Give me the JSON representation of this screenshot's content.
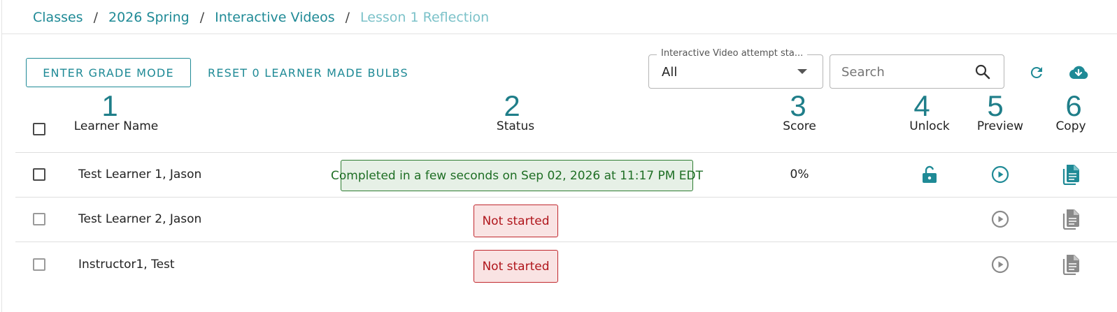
{
  "breadcrumb": {
    "items": [
      "Classes",
      "2026 Spring",
      "Interactive Videos"
    ],
    "separator": "/",
    "current": "Lesson 1 Reflection"
  },
  "toolbar": {
    "grade_mode_label": "ENTER GRADE MODE",
    "reset_bulbs_label": "RESET 0 LEARNER MADE BULBS",
    "attempt_filter": {
      "label": "Interactive Video attempt sta...",
      "value": "All"
    },
    "search": {
      "placeholder": "Search",
      "value": ""
    },
    "refresh_icon": "refresh-icon",
    "download_icon": "cloud-download-icon"
  },
  "columns": [
    {
      "number": "1",
      "label": "Learner Name"
    },
    {
      "number": "2",
      "label": "Status"
    },
    {
      "number": "3",
      "label": "Score"
    },
    {
      "number": "4",
      "label": "Unlock"
    },
    {
      "number": "5",
      "label": "Preview"
    },
    {
      "number": "6",
      "label": "Copy"
    }
  ],
  "rows": [
    {
      "name": "Test Learner 1, Jason",
      "status": "Completed in a few seconds on Sep 02, 2026 at 11:17 PM EDT",
      "status_type": "completed",
      "score": "0%",
      "unlock_icon": "lock-open-icon",
      "preview_icon": "play-circle-icon",
      "copy_icon": "copy-document-icon"
    },
    {
      "name": "Test Learner 2, Jason",
      "status": "Not started",
      "status_type": "not-started",
      "score": "",
      "preview_icon": "play-circle-icon",
      "copy_icon": "copy-document-icon"
    },
    {
      "name": "Instructor1, Test",
      "status": "Not started",
      "status_type": "not-started",
      "score": "",
      "preview_icon": "play-circle-icon",
      "copy_icon": "copy-document-icon"
    }
  ],
  "colors": {
    "accent": "#1f8a96",
    "completed_bg": "#e6f0e6",
    "completed_text": "#1e6e24",
    "not_started_bg": "#f9e3e3",
    "not_started_text": "#b0161c",
    "disabled_icon": "#8a8a8a"
  }
}
